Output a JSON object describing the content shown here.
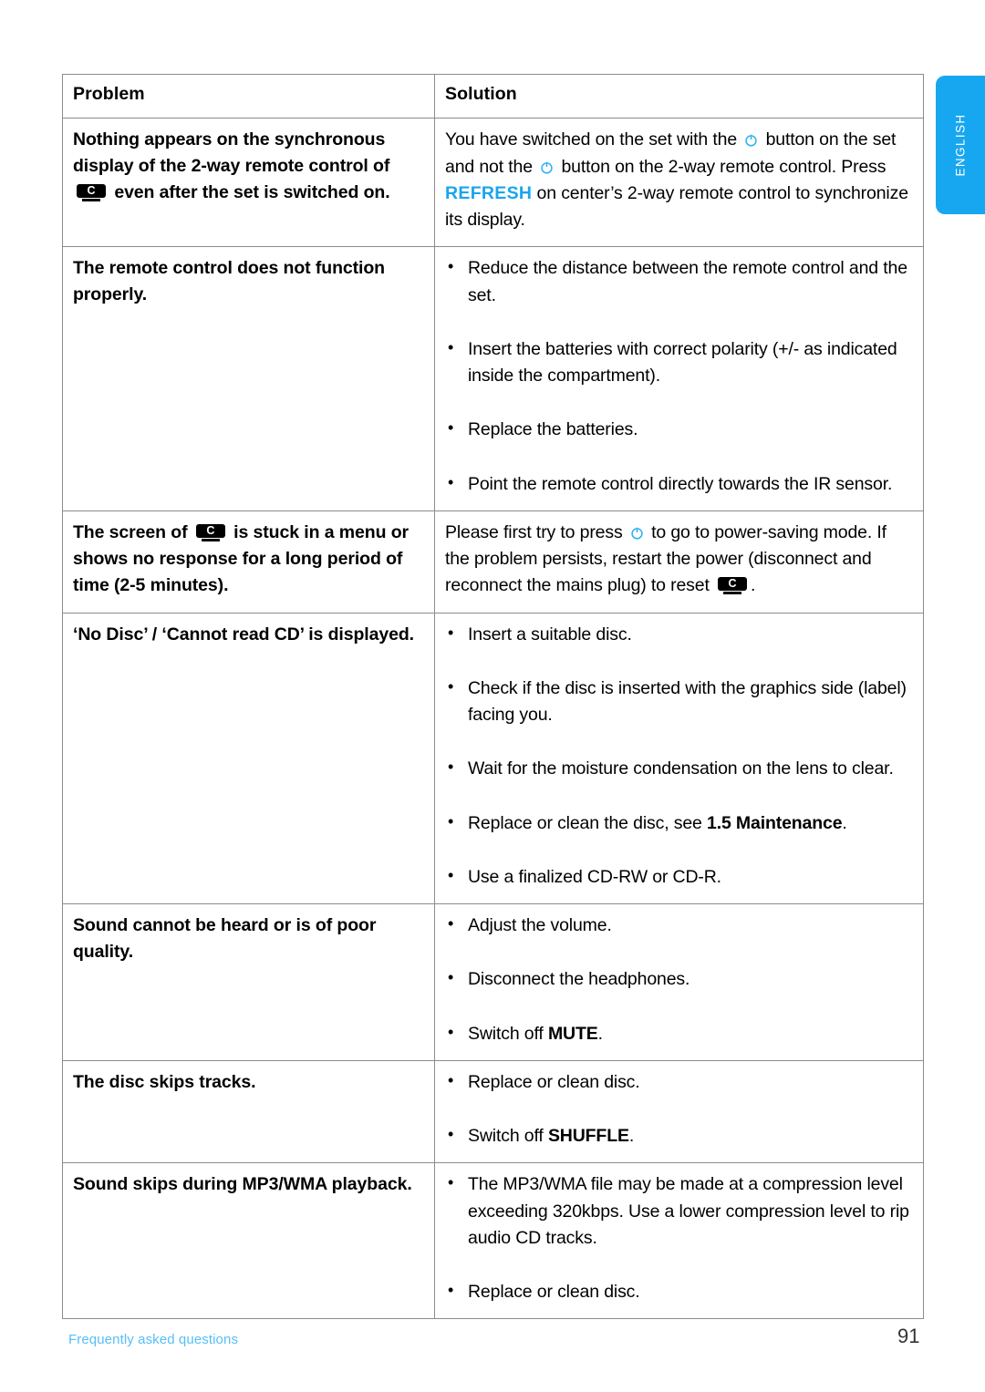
{
  "language_tab": {
    "label": "ENGLISH",
    "color": "#17A7F0"
  },
  "table": {
    "headers": {
      "problem": "Problem",
      "solution": "Solution"
    },
    "rows": [
      {
        "problem_parts": [
          {
            "type": "text",
            "value": "Nothing appears on the synchronous display of the 2-way remote control of "
          },
          {
            "type": "icon",
            "value": "center-unit-c-icon",
            "glyph": "C"
          },
          {
            "type": "text",
            "value": " even after the set is switched on."
          }
        ],
        "problem_plain": "Nothing appears on the synchronous display of the 2-way remote control of [C] even after the set is switched on.",
        "solution_parts": [
          {
            "type": "text",
            "value": "You have switched on the set with the "
          },
          {
            "type": "icon",
            "value": "power-icon"
          },
          {
            "type": "text",
            "value": " button on the set and not the "
          },
          {
            "type": "icon",
            "value": "power-icon"
          },
          {
            "type": "text",
            "value": " button on the 2-way remote control. Press "
          },
          {
            "type": "accent",
            "value": "REFRESH"
          },
          {
            "type": "text",
            "value": " on center’s 2-way remote control to synchronize its display."
          }
        ],
        "solution_plain": "You have switched on the set with the [power] button on the set and not the [power] button on the 2-way remote control. Press REFRESH on center’s 2-way remote control to synchronize its display."
      },
      {
        "problem_plain": "The remote control does not function properly.",
        "bullets": [
          "Reduce the distance between the remote control and the set.",
          "Insert the batteries with correct polarity (+/- as indicated inside the compartment).",
          "Replace the batteries.",
          "Point the remote control directly towards the IR sensor."
        ]
      },
      {
        "problem_parts": [
          {
            "type": "text",
            "value": "The screen of "
          },
          {
            "type": "icon",
            "value": "center-unit-c-icon",
            "glyph": "C"
          },
          {
            "type": "text",
            "value": " is stuck in a menu or shows no response for a long period of time (2-5 minutes)."
          }
        ],
        "problem_plain": "The screen of [C] is stuck in a menu or shows no response for a long period of time (2-5 minutes).",
        "solution_parts": [
          {
            "type": "text",
            "value": "Please first try to press "
          },
          {
            "type": "icon",
            "value": "power-icon"
          },
          {
            "type": "text",
            "value": " to go to power-saving mode. If the problem persists, restart the power (disconnect and reconnect the mains plug) to reset "
          },
          {
            "type": "icon",
            "value": "center-unit-c-icon",
            "glyph": "C"
          },
          {
            "type": "text",
            "value": "."
          }
        ],
        "solution_plain": "Please first try to press [power] to go to power-saving mode. If the problem persists, restart the power (disconnect and reconnect the mains plug) to reset [C]."
      },
      {
        "problem_plain": "‘No Disc’ / ‘Cannot read CD’ is displayed.",
        "bullets": [
          "Insert a suitable disc.",
          "Check if the disc is inserted with the graphics side (label) facing you.",
          "Wait for the moisture condensation on the lens to clear.",
          "Replace or clean the disc, see 1.5 Maintenance.",
          "Use a finalized CD-RW or CD-R."
        ],
        "bullet_bold_runs": {
          "3": "1.5 Maintenance"
        }
      },
      {
        "problem_plain": "Sound cannot be heard or is of poor quality.",
        "bullets": [
          "Adjust the volume.",
          "Disconnect the headphones.",
          "Switch off MUTE."
        ],
        "bullet_bold_runs": {
          "2": "MUTE"
        }
      },
      {
        "problem_plain": "The disc skips tracks.",
        "bullets": [
          "Replace or clean disc.",
          "Switch off SHUFFLE."
        ],
        "bullet_bold_runs": {
          "1": "SHUFFLE"
        }
      },
      {
        "problem_plain": "Sound skips during MP3/WMA playback.",
        "bullets": [
          "The MP3/WMA file may be made at a compression level exceeding 320kbps. Use a lower compression level to rip audio CD tracks.",
          "Replace or clean disc."
        ]
      }
    ]
  },
  "footer": {
    "caption": "Frequently asked questions",
    "page_number": "91",
    "caption_color": "#57BFF5"
  }
}
